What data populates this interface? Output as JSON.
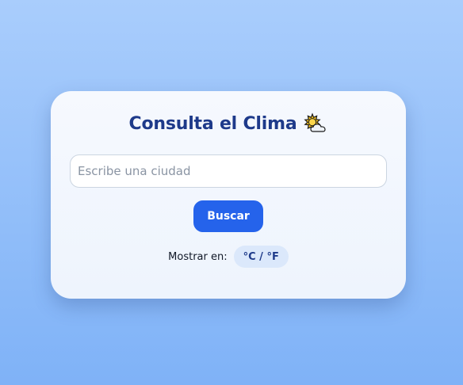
{
  "header": {
    "title": "Consulta el Clima",
    "icon": "sun-behind-cloud-icon"
  },
  "search": {
    "placeholder": "Escribe una ciudad",
    "value": "",
    "button_label": "Buscar"
  },
  "units": {
    "label": "Mostrar en:",
    "toggle_label": "°C / °F"
  },
  "colors": {
    "accent": "#2563eb",
    "title": "#1e3a8a",
    "toggle_bg": "#dbe8fb"
  }
}
